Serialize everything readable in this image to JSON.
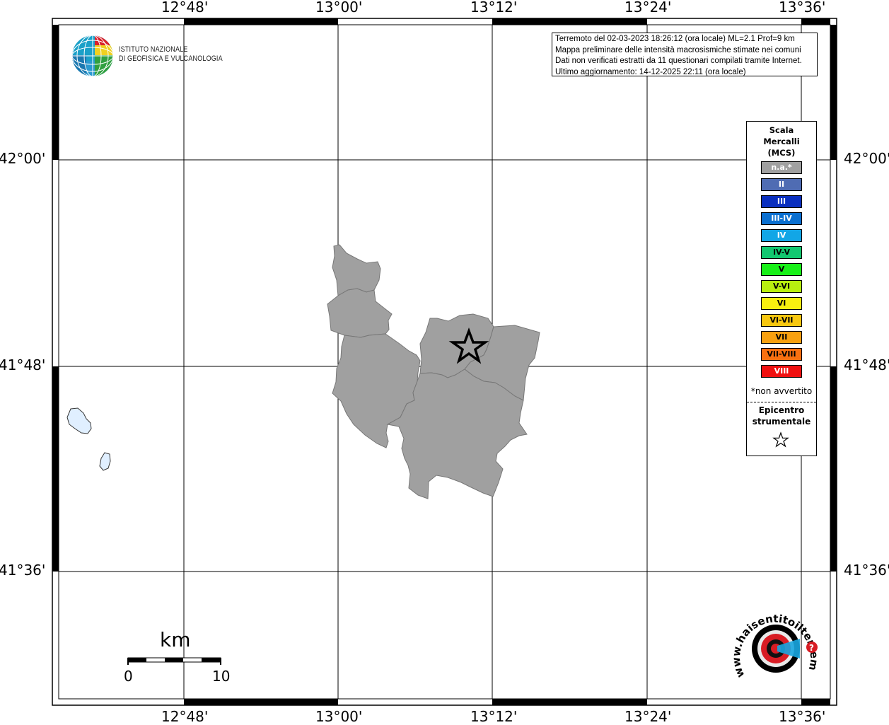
{
  "map": {
    "lon_labels": [
      "12°48'",
      "13°00'",
      "13°12'",
      "13°24'",
      "13°36'"
    ],
    "lat_labels": [
      "42°00'",
      "41°48'",
      "41°36'"
    ],
    "colors": {
      "frame": "#000000",
      "grid": "#000000",
      "not_felt": "#a0a0a0",
      "lake": "#e0efff"
    }
  },
  "info": {
    "line1": "Terremoto del 02-03-2023 18:26:12 (ora locale) ML=2.1 Prof=9 km",
    "line2": "Mappa preliminare delle intensità macrosismiche stimate nei comuni",
    "line3": "Dati non verificati estratti da 11 questionari compilati tramite Internet.",
    "line4": "Ultimo aggiornamento: 14-12-2025 22:11 (ora locale)"
  },
  "legend": {
    "title_line1": "Scala",
    "title_line2": "Mercalli",
    "title_line3": "(MCS)",
    "items": [
      {
        "label": "n.a.*",
        "color": "#a0a0a0",
        "text_color": "#ffffff"
      },
      {
        "label": "II",
        "color": "#4f6cb3",
        "text_color": "#ffffff"
      },
      {
        "label": "III",
        "color": "#0a2fbf",
        "text_color": "#ffffff"
      },
      {
        "label": "III-IV",
        "color": "#0a6fd0",
        "text_color": "#ffffff"
      },
      {
        "label": "IV",
        "color": "#12a6e6",
        "text_color": "#ffffff"
      },
      {
        "label": "IV-V",
        "color": "#12c870",
        "text_color": "#000000"
      },
      {
        "label": "V",
        "color": "#18f018",
        "text_color": "#000000"
      },
      {
        "label": "V-VI",
        "color": "#b8f010",
        "text_color": "#000000"
      },
      {
        "label": "VI",
        "color": "#f8f010",
        "text_color": "#000000"
      },
      {
        "label": "VI-VII",
        "color": "#f8c810",
        "text_color": "#000000"
      },
      {
        "label": "VII",
        "color": "#f8a010",
        "text_color": "#000000"
      },
      {
        "label": "VII-VIII",
        "color": "#f87010",
        "text_color": "#000000"
      },
      {
        "label": "VIII",
        "color": "#f01010",
        "text_color": "#ffffff"
      }
    ],
    "note": "*non avvertito",
    "epicenter_line1": "Epicentro",
    "epicenter_line2": "strumentale"
  },
  "scale_bar": {
    "unit": "km",
    "start": "0",
    "end": "10"
  },
  "logos": {
    "ingv_line1": "ISTITUTO NAZIONALE",
    "ingv_line2": "DI GEOFISICA E VULCANOLOGIA",
    "hsit_text": "www.haisentitoilterremoto.it",
    "hsit_badge": "?"
  }
}
